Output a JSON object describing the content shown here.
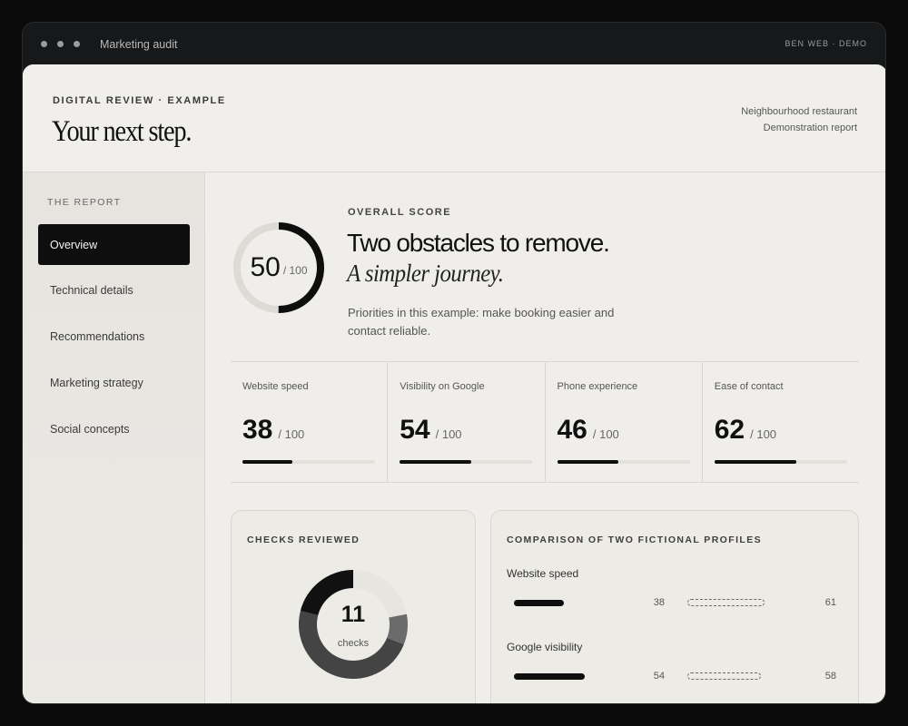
{
  "window": {
    "title": "Marketing audit",
    "brand": "BEN WEB · DEMO"
  },
  "header": {
    "eyebrow": "DIGITAL REVIEW · EXAMPLE",
    "title": "Your next step.",
    "client_line1": "Neighbourhood restaurant",
    "client_line2": "Demonstration report"
  },
  "sidebar": {
    "label": "THE REPORT",
    "items": [
      {
        "label": "Overview",
        "active": true
      },
      {
        "label": "Technical details",
        "active": false
      },
      {
        "label": "Recommendations",
        "active": false
      },
      {
        "label": "Marketing strategy",
        "active": false
      },
      {
        "label": "Social concepts",
        "active": false
      }
    ]
  },
  "overview": {
    "label": "OVERALL SCORE",
    "score": 50,
    "score_max": "/ 100",
    "title": "Two obstacles to remove.",
    "subtitle": "A simpler journey.",
    "description": "Priorities in this example: make booking easier and contact reliable."
  },
  "metrics": [
    {
      "label": "Website speed",
      "value": 38,
      "max": "/ 100"
    },
    {
      "label": "Visibility on Google",
      "value": 54,
      "max": "/ 100"
    },
    {
      "label": "Phone experience",
      "value": 46,
      "max": "/ 100"
    },
    {
      "label": "Ease of contact",
      "value": 62,
      "max": "/ 100"
    }
  ],
  "checks_card": {
    "title": "CHECKS REVIEWED",
    "count": 11,
    "count_label": "checks",
    "segments": [
      {
        "share": 0.22,
        "color": "#e7e5e0"
      },
      {
        "share": 0.09,
        "color": "#6b6b6b"
      },
      {
        "share": 0.48,
        "color": "#444444"
      },
      {
        "share": 0.21,
        "color": "#111111"
      }
    ]
  },
  "comparison_card": {
    "title": "COMPARISON OF TWO FICTIONAL PROFILES",
    "rows": [
      {
        "label": "Website speed",
        "a": 38,
        "b": 61
      },
      {
        "label": "Google visibility",
        "a": 54,
        "b": 58
      }
    ]
  },
  "colors": {
    "accent": "#0e0e0e",
    "surface": "#efeeea",
    "sidebar": "#e8e6e1"
  }
}
